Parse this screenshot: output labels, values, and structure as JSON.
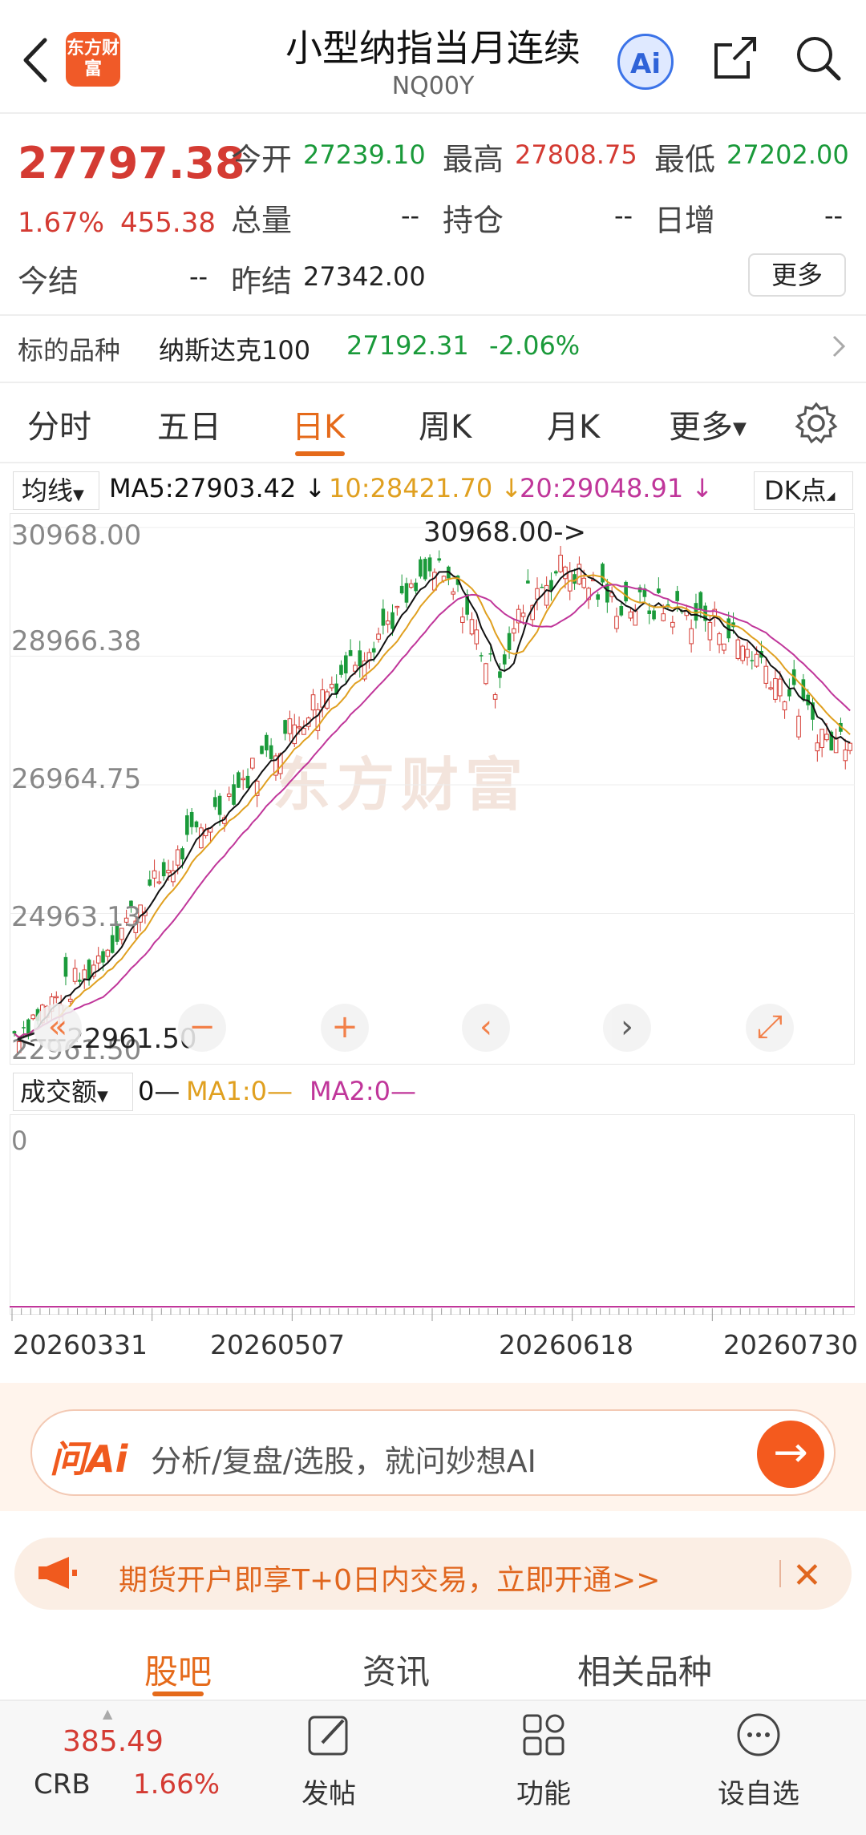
{
  "header": {
    "title": "小型纳指当月连续",
    "code": "NQ00Y",
    "logo_text": "东方财富",
    "ai_label": "Ai"
  },
  "quote": {
    "price": "27797.38",
    "change_pct": "1.67%",
    "change_abs": "455.38",
    "fields": {
      "open_label": "今开",
      "open": "27239.10",
      "high_label": "最高",
      "high": "27808.75",
      "low_label": "最低",
      "low": "27202.00",
      "volume_label": "总量",
      "volume": "--",
      "oi_label": "持仓",
      "oi": "--",
      "daily_inc_label": "日增",
      "daily_inc": "--",
      "settle_label": "今结",
      "settle": "--",
      "prev_settle_label": "昨结",
      "prev_settle": "27342.00"
    },
    "more_label": "更多"
  },
  "underlying": {
    "label": "标的品种",
    "name": "纳斯达克100",
    "price": "27192.31",
    "change": "-2.06%"
  },
  "tabs": [
    {
      "label": "分时",
      "active": false
    },
    {
      "label": "五日",
      "active": false
    },
    {
      "label": "日K",
      "active": true
    },
    {
      "label": "周K",
      "active": false
    },
    {
      "label": "月K",
      "active": false
    },
    {
      "label": "更多",
      "active": false
    }
  ],
  "ma_legend": {
    "selector": "均线",
    "ma5": "MA5:27903.42 ↓",
    "ma10": "10:28421.70 ↓",
    "ma20": "20:29048.91 ↓",
    "dk": "DK点"
  },
  "chart_data": {
    "type": "candlestick",
    "y_ticks": [
      "30968.00",
      "28966.38",
      "26964.75",
      "24963.13",
      "22961.50"
    ],
    "ylim": [
      22961.5,
      30968.0
    ],
    "max_annotation": "30968.00->",
    "min_annotation": "<---22961.50",
    "x_ticks": [
      "20260331",
      "20260507",
      "20260618",
      "20260730"
    ],
    "series": [
      {
        "name": "MA5",
        "color": "#111111"
      },
      {
        "name": "10",
        "color": "#e0a020"
      },
      {
        "name": "20",
        "color": "#c0369a"
      }
    ],
    "candle_up_color": "#d43b33",
    "candle_down_color": "#1a9a3a"
  },
  "volume": {
    "selector": "成交额",
    "val": "0—",
    "ma1": "MA1:0—",
    "ma2": "MA2:0—",
    "axis_zero": "0"
  },
  "ai_bar": {
    "brand": "问Ai",
    "placeholder": "分析/复盘/选股，就问妙想AI"
  },
  "promo": {
    "text": "期货开户即享T+0日内交易，立即开通>>"
  },
  "bottom_tabs": [
    "股吧",
    "资讯",
    "相关品种"
  ],
  "nav": {
    "crb_value": "385.49",
    "crb_label": "CRB",
    "crb_change": "1.66%",
    "post": "发帖",
    "func": "功能",
    "watch": "设自选"
  },
  "colors": {
    "accent": "#e56a1a",
    "up": "#d43b33",
    "down": "#1a9a3a"
  }
}
